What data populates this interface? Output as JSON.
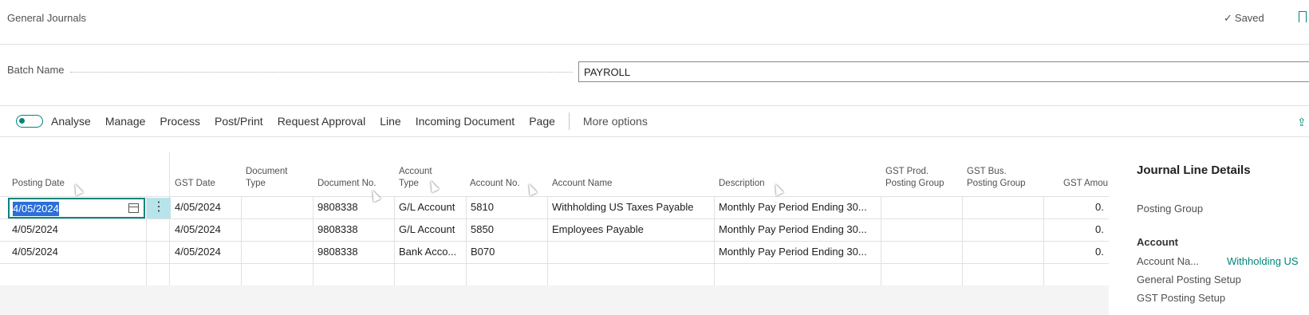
{
  "header": {
    "title": "General Journals",
    "saved_label": "Saved"
  },
  "batch": {
    "label": "Batch Name",
    "value": "PAYROLL"
  },
  "toolbar": {
    "items": [
      "Analyse",
      "Manage",
      "Process",
      "Post/Print",
      "Request Approval",
      "Line",
      "Incoming Document",
      "Page"
    ],
    "more": "More options"
  },
  "columns": {
    "posting_date": "Posting Date",
    "gst_date": "GST Date",
    "document_type_1": "Document",
    "document_type_2": "Type",
    "document_no": "Document No.",
    "account_type_1": "Account",
    "account_type_2": "Type",
    "account_no": "Account No.",
    "account_name": "Account Name",
    "description": "Description",
    "gst_prod_1": "GST Prod.",
    "gst_prod_2": "Posting Group",
    "gst_bus_1": "GST Bus.",
    "gst_bus_2": "Posting Group",
    "gst_amount": "GST Amou"
  },
  "rows": [
    {
      "posting_date": "4/05/2024",
      "gst_date": "4/05/2024",
      "document_no": "9808338",
      "account_type": "G/L Account",
      "account_no": "5810",
      "account_name": "Withholding US Taxes Payable",
      "description": "Monthly Pay Period Ending 30...",
      "gst_amount": "0."
    },
    {
      "posting_date": "4/05/2024",
      "gst_date": "4/05/2024",
      "document_no": "9808338",
      "account_type": "G/L Account",
      "account_no": "5850",
      "account_name": "Employees Payable",
      "description": "Monthly Pay Period Ending 30...",
      "gst_amount": "0."
    },
    {
      "posting_date": "4/05/2024",
      "gst_date": "4/05/2024",
      "document_no": "9808338",
      "account_type": "Bank Acco...",
      "account_no": "B070",
      "account_name": "",
      "description": "Monthly Pay Period Ending 30...",
      "gst_amount": "0."
    }
  ],
  "details": {
    "title": "Journal Line Details",
    "posting_group": "Posting Group",
    "account_section": "Account",
    "account_name_label": "Account Na...",
    "account_name_value": "Withholding US",
    "general_posting_setup": "General Posting Setup",
    "gst_posting_setup": "GST Posting Setup"
  },
  "icons": {
    "saved": "checkmark-icon",
    "bookmark": "bookmark-icon",
    "share": "share-icon",
    "calendar": "calendar-icon",
    "row_menu": "vertical-ellipsis-icon"
  },
  "colors": {
    "accent": "#00857c",
    "selection": "#2a6fdb",
    "row_action_bg": "#b9e3ea"
  }
}
